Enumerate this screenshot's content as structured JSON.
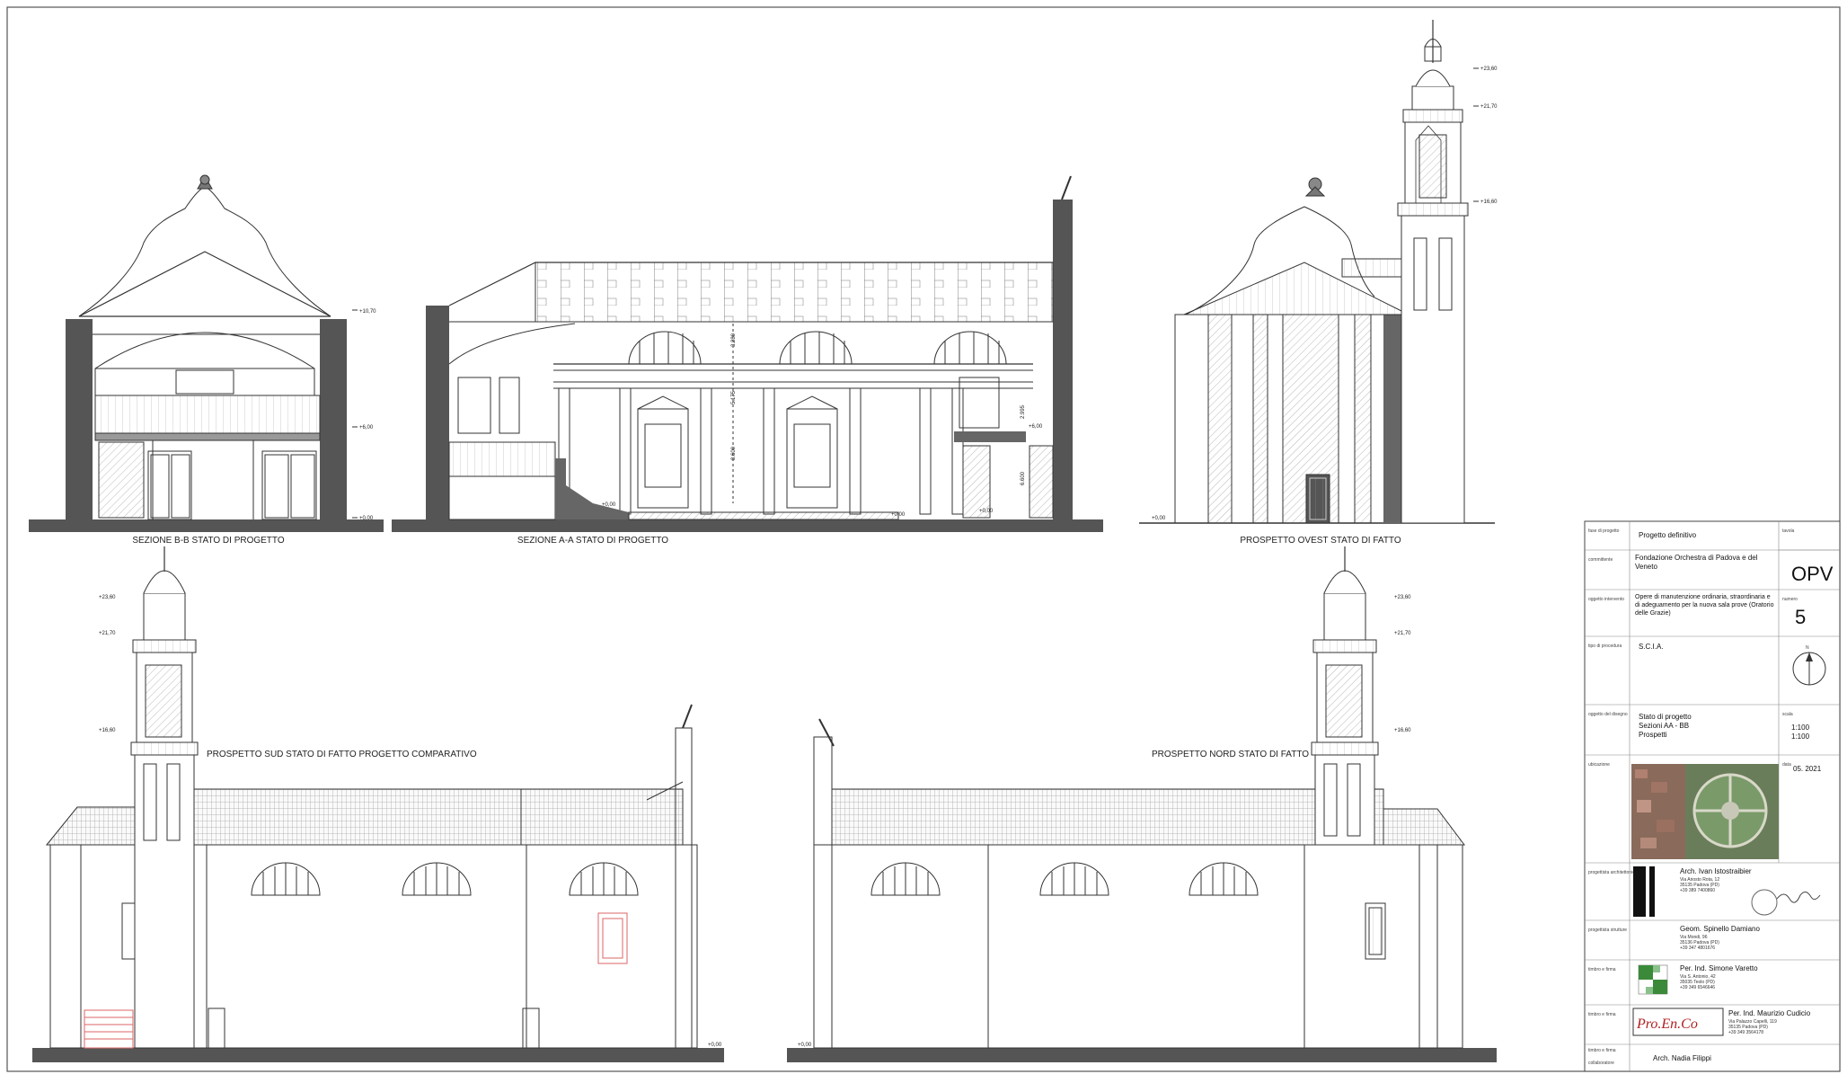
{
  "drawings": {
    "sezione_bb": "SEZIONE B-B STATO DI PROGETTO",
    "sezione_aa": "SEZIONE A-A STATO DI PROGETTO",
    "prospetto_ovest": "PROSPETTO OVEST STATO DI FATTO",
    "prospetto_sud": "PROSPETTO SUD STATO DI FATTO PROGETTO COMPARATIVO",
    "prospetto_nord": "PROSPETTO NORD STATO DI FATTO"
  },
  "levels": {
    "a": "+23,60",
    "b": "+21,70",
    "c": "+16,60",
    "d": "+10,70",
    "e": "+6,00",
    "f": "+0,00"
  },
  "dimensions": {
    "d1": "3.280",
    "d2": "5.175",
    "d3": "8.600",
    "d4": "2.995",
    "d5": "6.600"
  },
  "titleblock": {
    "fase_label": "fase di progetto",
    "fase": "Progetto definitivo",
    "committente_label": "committente",
    "committente": "Fondazione Orchestra di Padova e del Veneto",
    "oggetto_label": "oggetto intervento",
    "oggetto": "Opere di manutenzione ordinaria, straordinaria e di adeguamento per la nuova sala prove (Oratorio delle Grazie)",
    "procedura_label": "tipo di procedura",
    "procedura": "S.C.I.A.",
    "disegno_label": "oggetto del disegno",
    "disegno_1": "Stato di progetto",
    "disegno_2": "Sezioni AA - BB",
    "disegno_3": "Prospetti",
    "ubicazione_label": "ubicazione",
    "codice_label": "tavola",
    "codice": "OPV",
    "numero_label": "numero",
    "numero": "5",
    "scala_label": "scala",
    "scala_1": "1:100",
    "scala_2": "1:100",
    "data_label": "data",
    "data": "05. 2021",
    "nord": "N",
    "progettista_label": "progettista architettonico",
    "progettista": "Arch. Ivan Istostraibier",
    "progettista_addr": "Via Ariosto Rota, 12\n35135 Padova (PD)\n+39 389 7400860",
    "strutture_label": "progettista strutture",
    "strutture": "Geom. Spinello Damiano",
    "strutture_addr": "Via Mondi, 96\n35136 Padova (PD)\n+39 347 4801676",
    "impianti_label": "timbro e firma",
    "impianti": "Per. Ind. Simone Varetto",
    "impianti_addr": "Via S. Antonio, 42\n35035 Teolo (PD)\n+39 349 6546646",
    "elettrico_label": "timbro e firma",
    "elettrico": "Per. Ind. Maurizio Cudicio",
    "elettrico_addr": "Via Palazzo Capelli, 119\n35135 Padova (PD)\n+39 349 3564178",
    "proenco": "Pro.En.Co",
    "collaboratore_label": "collaboratore",
    "collaboratore": "Arch. Nadia Filippi",
    "firma_label": "timbro e firma"
  }
}
